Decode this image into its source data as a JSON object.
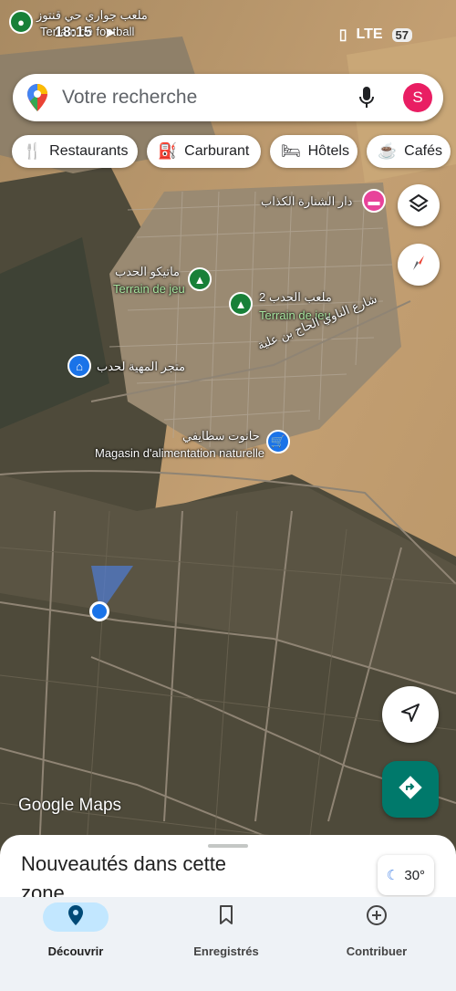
{
  "status_bar": {
    "time": "18:15",
    "network": "LTE",
    "battery": "57"
  },
  "map_top_label": {
    "arabic": "ملعب جواري حي قنتوز",
    "latin": "Terrain de football"
  },
  "search": {
    "placeholder": "Votre recherche",
    "avatar_letter": "S"
  },
  "chips": [
    {
      "label": "Restaurants",
      "icon": "restaurant-icon"
    },
    {
      "label": "Carburant",
      "icon": "gas-station-icon"
    },
    {
      "label": "Hôtels",
      "icon": "hotel-bed-icon"
    },
    {
      "label": "Cafés",
      "icon": "coffee-cup-icon"
    }
  ],
  "places": [
    {
      "arabic": "دار الشنارة الكذاب",
      "latin": ""
    },
    {
      "arabic": "ماتيكو الحدب",
      "latin": "Terrain de jeu"
    },
    {
      "arabic": "ملعب الحدب 2",
      "latin": "Terrain de jeu"
    },
    {
      "arabic": "شارع الناوي الحاج بن علية",
      "latin": ""
    },
    {
      "arabic": "متجر المهية لحدب",
      "latin": ""
    },
    {
      "arabic": "حانوت سطايفي",
      "latin": "Magasin d'alimentation naturelle"
    }
  ],
  "watermark": "Google Maps",
  "sheet": {
    "title": "Nouveautés dans cette zone...",
    "temperature": "30°"
  },
  "bottom_nav": [
    {
      "label": "Découvrir",
      "icon": "location-pin-icon",
      "active": true
    },
    {
      "label": "Enregistrés",
      "icon": "bookmark-icon",
      "active": false
    },
    {
      "label": "Contribuer",
      "icon": "add-circle-icon",
      "active": false
    }
  ],
  "colors": {
    "accent": "#00796b",
    "avatar": "#e91e63",
    "location_dot": "#1a73e8",
    "nav_active": "#c2e7ff"
  }
}
